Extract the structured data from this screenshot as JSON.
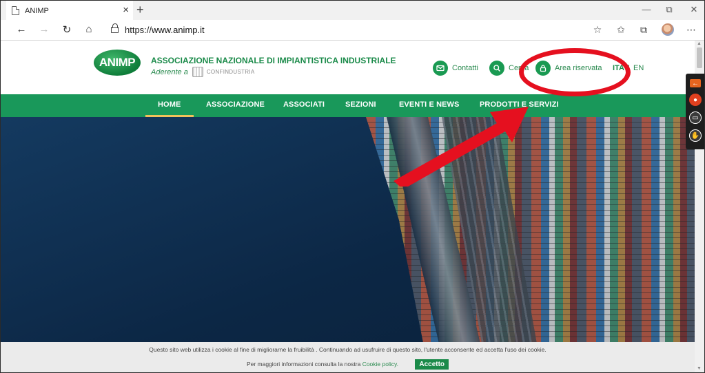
{
  "browser": {
    "tab_title": "ANIMP",
    "tab_close": "×",
    "new_tab": "+",
    "url_prefix": "https://",
    "url_domain": "www.animp.it",
    "minimize": "—",
    "restore": "⧉",
    "close": "✕",
    "back": "←",
    "forward": "→",
    "refresh": "↻",
    "home": "⌂",
    "more": "⋯"
  },
  "header": {
    "logo": "ANIMP",
    "assoc_name": "ASSOCIAZIONE NAZIONALE DI IMPIANTISTICA INDUSTRIALE",
    "adherent": "Aderente a",
    "confindustria": "CONFINDUSTRIA",
    "contatti": "Contatti",
    "cerca": "Cerca",
    "area_riservata": "Area riservata",
    "lang_ita": "ITA",
    "lang_sep": "|",
    "lang_en": "EN"
  },
  "nav": {
    "items": [
      {
        "label": "HOME"
      },
      {
        "label": "ASSOCIAZIONE"
      },
      {
        "label": "ASSOCIATI"
      },
      {
        "label": "SEZIONI"
      },
      {
        "label": "EVENTI E NEWS"
      },
      {
        "label": "PRODOTTI E SERVIZI"
      }
    ]
  },
  "cookie": {
    "line1": "Questo sito web utilizza i cookie al fine di migliorarne la fruibilità . Continuando ad usufruire di questo sito, l'utente acconsente ed accetta l'uso dei cookie.",
    "line2_prefix": "Per maggiori informazioni consulta la nostra",
    "policy_link": "Cookie policy.",
    "accept": "Accetto"
  },
  "colors": {
    "brand_green": "#19985a",
    "annotation_red": "#e5101f",
    "nav_underline": "#f2c25a"
  }
}
